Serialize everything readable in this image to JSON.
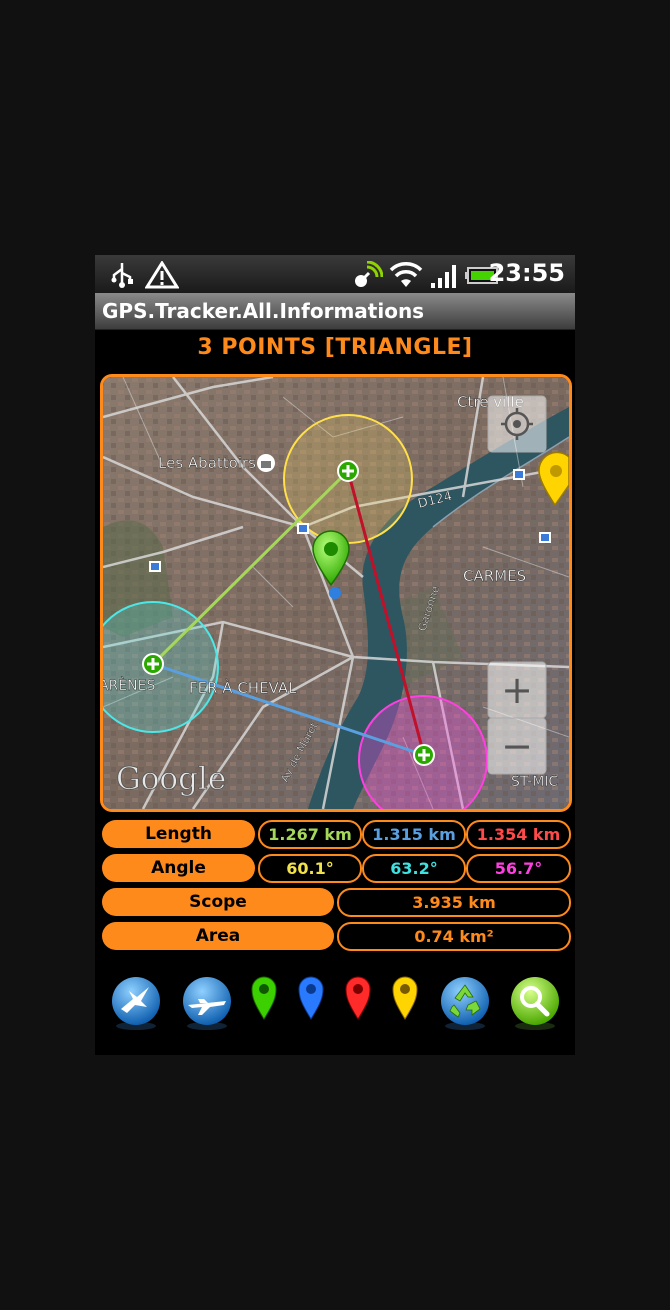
{
  "statusbar": {
    "time": "23:55",
    "icons": [
      "usb-icon",
      "warning-icon",
      "gps-icon",
      "wifi-icon",
      "signal-icon",
      "battery-icon"
    ]
  },
  "app": {
    "title": "GPS.Tracker.All.Informations"
  },
  "heading": "3 POINTS [TRIANGLE]",
  "map": {
    "labels": {
      "les_abattoirs": "Les Abattoirs",
      "centre_ville": "Ctre ville",
      "d124": "D124",
      "carmes": "CARMES",
      "garonne": "Garonne",
      "arenes": "ARÈNES",
      "fer_a_cheval": "FER À CHEVAL",
      "av_muret": "Av de Muret",
      "st_mic": "ST-MIC",
      "google": "Google"
    },
    "zoom_in": "+",
    "zoom_out": "−"
  },
  "stats": {
    "length": {
      "label": "Length",
      "values": [
        "1.267 km",
        "1.315 km",
        "1.354 km"
      ]
    },
    "angle": {
      "label": "Angle",
      "values": [
        "60.1°",
        "63.2°",
        "56.7°"
      ]
    },
    "scope": {
      "label": "Scope",
      "value": "3.935 km"
    },
    "area": {
      "label": "Area",
      "value": "0.74 km²"
    }
  },
  "colors": {
    "accent": "#ff8a1c",
    "length_1": "#a5d85a",
    "length_2": "#5aa0e0",
    "length_3": "#ff4a4a",
    "angle_1": "#f2e24a",
    "angle_2": "#3fe0e0",
    "angle_3": "#ff40e0"
  },
  "toolbar": {
    "icons": [
      "satellite-view-icon",
      "plane-view-icon",
      "green-marker-icon",
      "blue-marker-icon",
      "red-marker-icon",
      "yellow-marker-icon",
      "recycle-icon",
      "search-icon"
    ]
  }
}
